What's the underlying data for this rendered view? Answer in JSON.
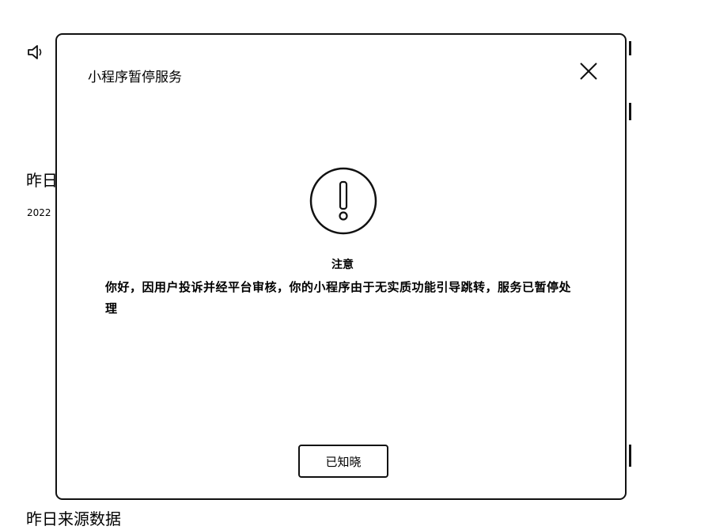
{
  "background": {
    "speaker_icon": "speaker-icon",
    "yesterday_heading": "昨日",
    "date_fragment": "2022",
    "source_heading": "昨日来源数据"
  },
  "modal": {
    "title": "小程序暂停服务",
    "close_icon": "close-icon",
    "alert_icon": "exclamation-circle-icon",
    "notice_heading": "注意",
    "notice_body": "你好，因用户投诉并经平台审核，你的小程序由于无实质功能引导跳转，服务已暂停处理",
    "confirm_button": "已知晓"
  }
}
